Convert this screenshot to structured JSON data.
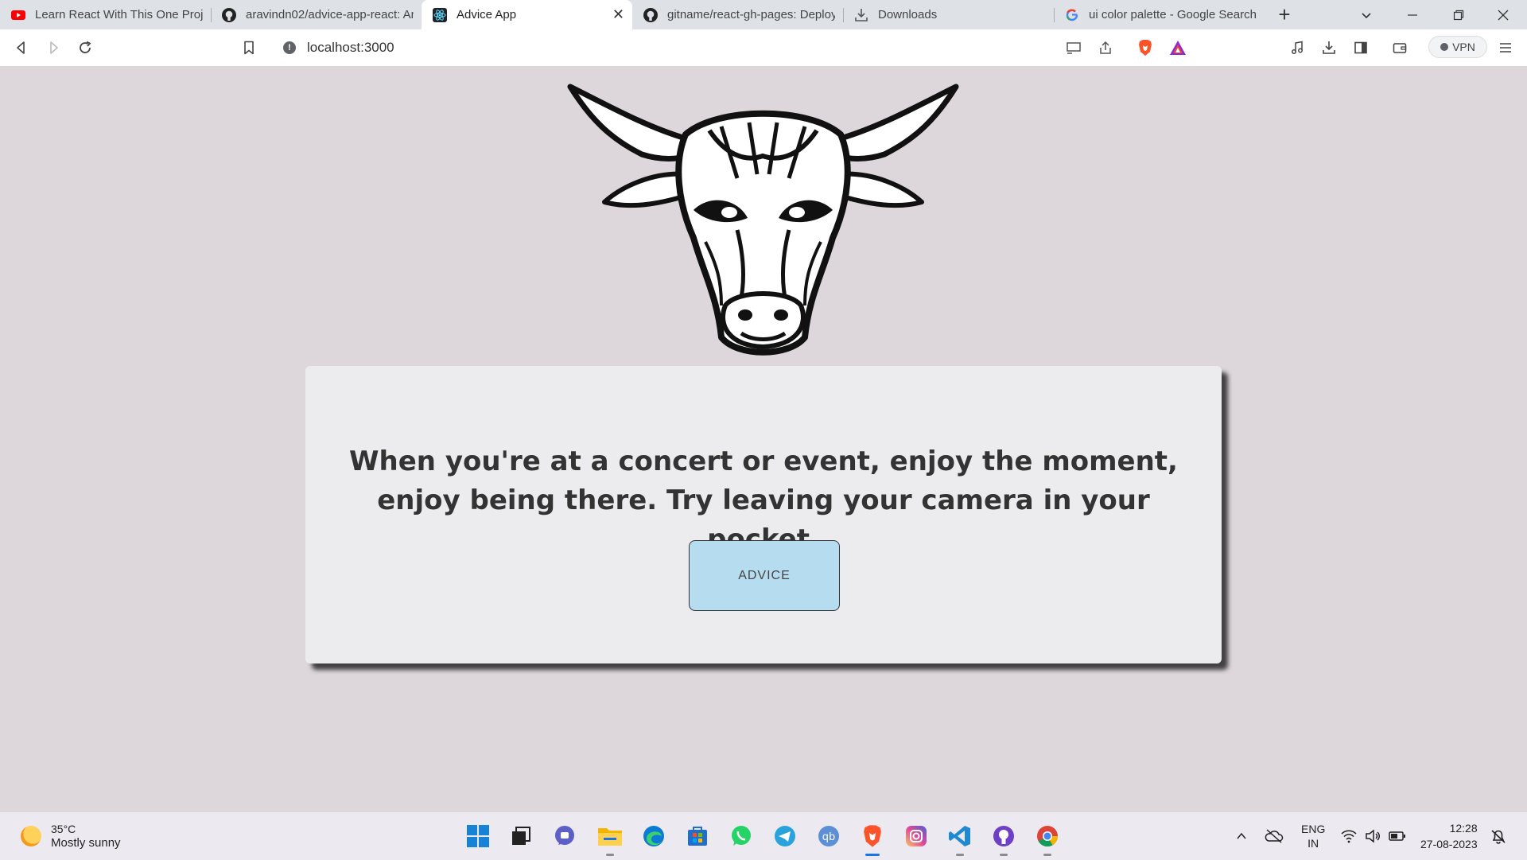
{
  "browser": {
    "tabs": [
      {
        "title": "Learn React With This One Project",
        "icon": "youtube-icon",
        "active": false
      },
      {
        "title": "aravindn02/advice-app-react: An",
        "icon": "github-icon",
        "active": false
      },
      {
        "title": "Advice App",
        "icon": "react-icon",
        "active": true
      },
      {
        "title": "gitname/react-gh-pages: Deploy",
        "icon": "github-icon",
        "active": false
      },
      {
        "title": "Downloads",
        "icon": "download-icon",
        "active": false
      },
      {
        "title": "ui color palette - Google Search",
        "icon": "google-icon",
        "active": false
      }
    ],
    "new_tab": "+",
    "close_tab": "✕",
    "url": "localhost:3000",
    "vpn_label": "VPN"
  },
  "app": {
    "advice": "When you're at a concert or event, enjoy the moment, enjoy being there. Try leaving your camera in your pocket.",
    "button_label": "ADVICE",
    "logo": "bull-head-logo"
  },
  "taskbar": {
    "weather_temp": "35°C",
    "weather_desc": "Mostly sunny",
    "lang_line1": "ENG",
    "lang_line2": "IN",
    "time": "12:28",
    "date": "27-08-2023"
  },
  "colors": {
    "page_bg": "#ddd7dc",
    "card_bg": "#ececee",
    "button_bg": "#b6dcf0",
    "text": "#333333"
  }
}
